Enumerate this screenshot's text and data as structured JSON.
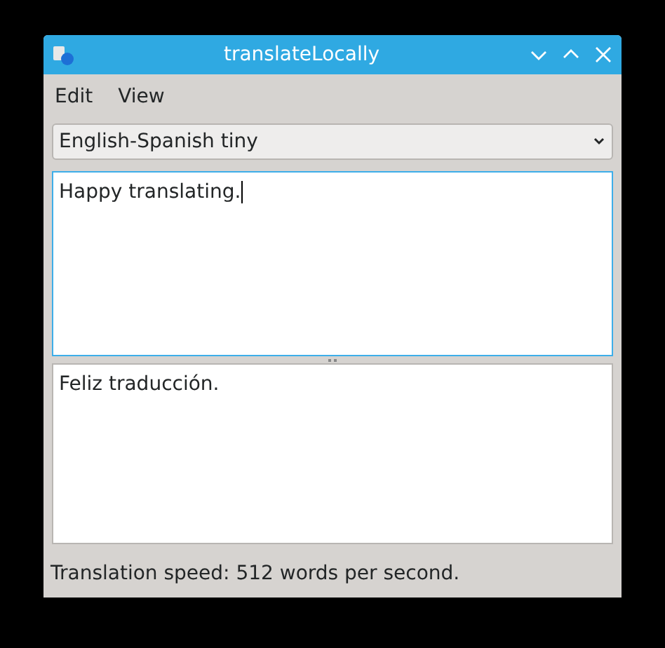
{
  "window": {
    "title": "translateLocally"
  },
  "menu": [
    {
      "label": "Edit"
    },
    {
      "label": "View"
    }
  ],
  "model_select": {
    "value": "English-Spanish tiny"
  },
  "source": {
    "value": "Happy translating.",
    "focused": true
  },
  "translation": {
    "value": "Feliz traducción."
  },
  "status_bar": "Translation speed: 512 words per second."
}
